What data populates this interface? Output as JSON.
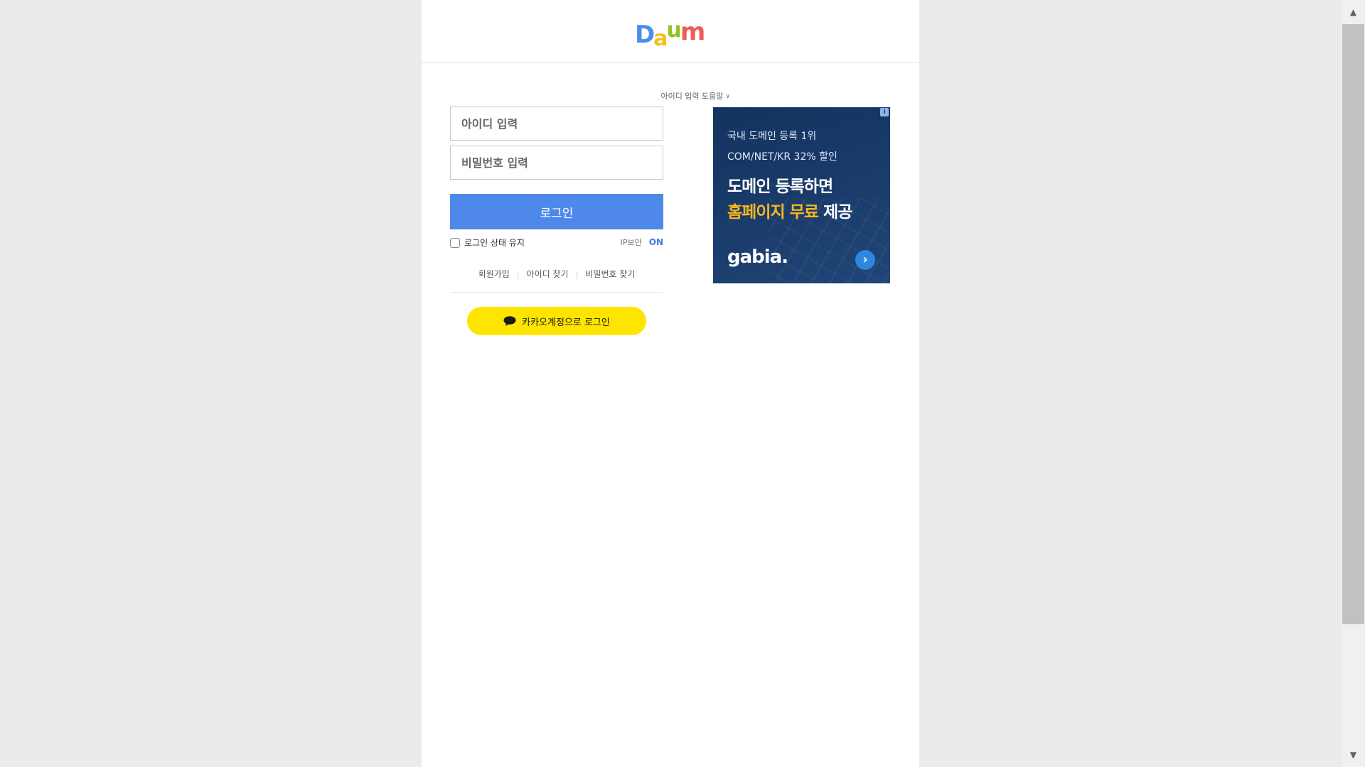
{
  "header": {
    "logo": {
      "letters": [
        "D",
        "a",
        "u",
        "m"
      ],
      "colors": [
        "#4b8eeb",
        "#f4bf1f",
        "#95c11f",
        "#ef5a5a"
      ]
    }
  },
  "login": {
    "help_link": "아이디 입력 도움말",
    "id_placeholder": "아이디 입력",
    "pw_placeholder": "비밀번호 입력",
    "login_button": "로그인",
    "keep_login_label": "로그인 상태 유지",
    "ip_security_label": "IP보안",
    "ip_security_state": "ON",
    "links": {
      "signup": "회원가입",
      "find_id": "아이디 찾기",
      "find_pw": "비밀번호 찾기",
      "separator": "|"
    },
    "kakao_button": "카카오계정으로 로그인",
    "accent_color": "#4e89ea",
    "kakao_color": "#fee500"
  },
  "ad": {
    "info_badge": "i",
    "sub_line1": "국내 도메인 등록 1위",
    "sub_line2": "COM/NET/KR 32% 할인",
    "head_line1": "도메인 등록하면",
    "head_line2_highlight": "홈페이지 무료",
    "head_line2_rest": " 제공",
    "brand": "gabia.",
    "arrow_icon": "chevron-right-icon",
    "highlight_color": "#f6b51f"
  },
  "scrollbar": {
    "up_icon": "▲",
    "down_icon": "▼"
  }
}
